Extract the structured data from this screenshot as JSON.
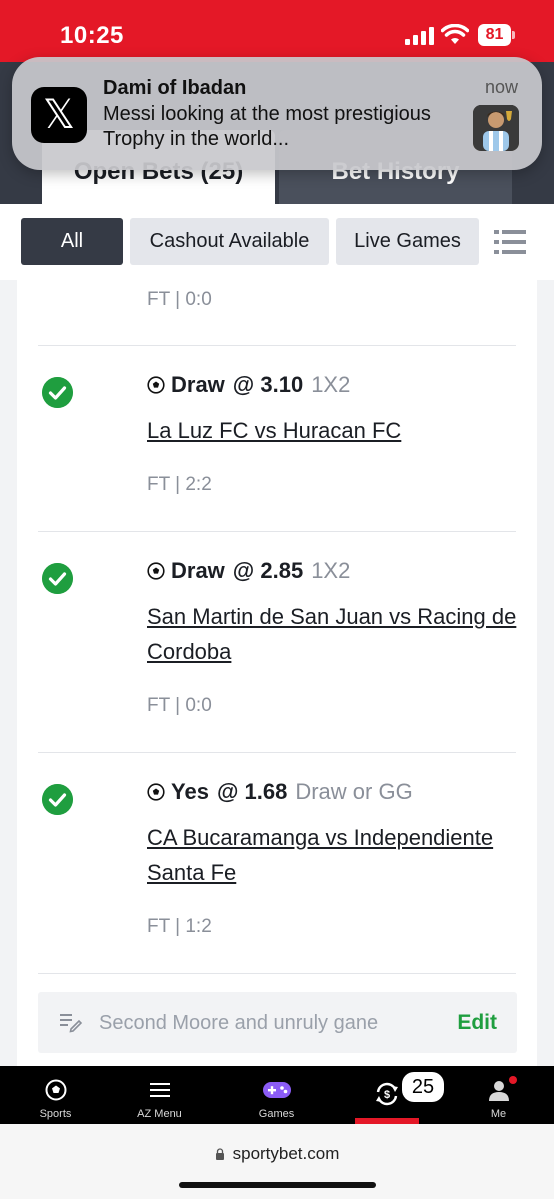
{
  "status_bar": {
    "time": "10:25",
    "battery": "81"
  },
  "notification": {
    "sender": "Dami of Ibadan",
    "message": "Messi looking at the most prestigious Trophy in the world...",
    "time": "now",
    "app_icon": "𝕏"
  },
  "tabs": {
    "open_bets": "Open Bets (25)",
    "bet_history": "Bet History"
  },
  "filters": {
    "all": "All",
    "cashout": "Cashout Available",
    "live": "Live Games"
  },
  "first_result": "FT | 0:0",
  "bets": [
    {
      "pick": "Draw",
      "odds": "@ 3.10",
      "market": "1X2",
      "match": "La Luz FC vs Huracan FC",
      "result": "FT | 2:2"
    },
    {
      "pick": "Draw",
      "odds": "@ 2.85",
      "market": "1X2",
      "match": "San Martin de San Juan vs Racing de Cordoba",
      "result": "FT | 0:0"
    },
    {
      "pick": "Yes",
      "odds": "@ 1.68",
      "market": "Draw or GG",
      "match": "CA Bucaramanga vs Independiente Santa Fe",
      "result": "FT | 1:2"
    }
  ],
  "note": {
    "text": "Second Moore and unruly gane",
    "edit_label": "Edit"
  },
  "bottom_nav": {
    "sports": "Sports",
    "az_menu": "AZ Menu",
    "games": "Games",
    "betslip_count": "25",
    "me": "Me"
  },
  "browser": {
    "url": "sportybet.com"
  },
  "colors": {
    "brand_red": "#e41827",
    "success_green": "#1f9e3f",
    "dark": "#353a45"
  }
}
